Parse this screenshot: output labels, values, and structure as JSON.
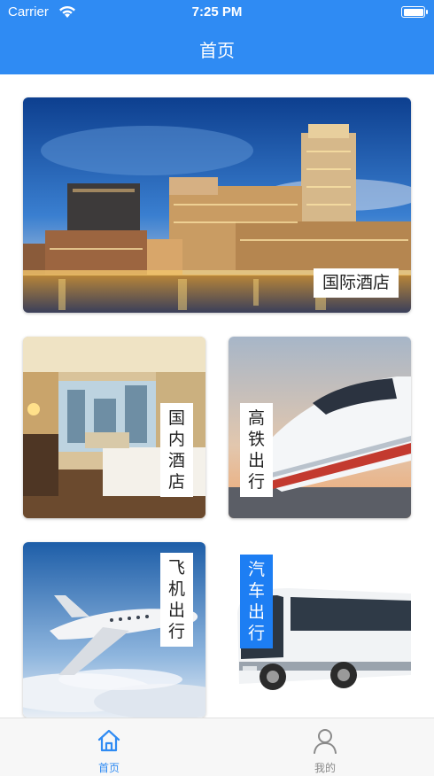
{
  "status_bar": {
    "carrier": "Carrier",
    "time": "7:25 PM"
  },
  "nav": {
    "title": "首页"
  },
  "cards": {
    "intl_hotel": {
      "label": "国际酒店"
    },
    "domestic_hotel": {
      "label": "国内酒店"
    },
    "high_speed_rail": {
      "label": "高铁出行"
    },
    "flight": {
      "label": "飞机出行"
    },
    "bus": {
      "label": "汽车出行"
    }
  },
  "tabbar": {
    "tabs": [
      {
        "label": "首页",
        "icon": "home-icon",
        "active": true
      },
      {
        "label": "我的",
        "icon": "user-icon",
        "active": false
      }
    ]
  },
  "colors": {
    "accent": "#2f8bf3",
    "tab_active": "#2f8bf3",
    "tab_inactive": "#8a8a8a",
    "bus_label_bg": "#1d7ef3"
  }
}
